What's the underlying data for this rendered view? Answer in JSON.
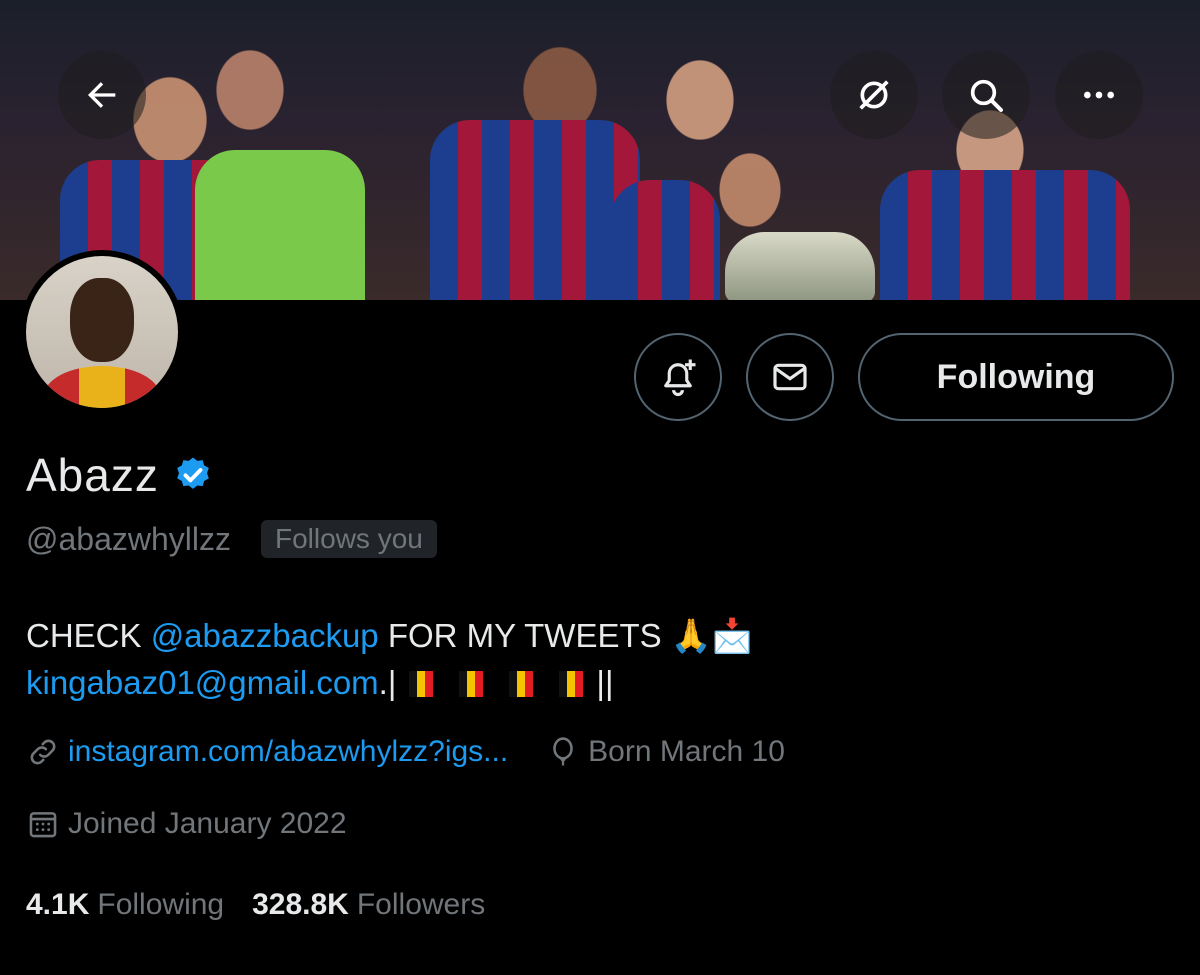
{
  "header": {
    "back_icon": "arrow-left-icon",
    "grok_icon": "slash-circle-icon",
    "search_icon": "search-icon",
    "more_icon": "more-horizontal-icon"
  },
  "profile": {
    "name": "Abazz",
    "verified": true,
    "handle": "@abazwhyllzz",
    "follows_you_label": "Follows you",
    "bio_line1_prefix": "CHECK ",
    "bio_mention": "@abazzbackup",
    "bio_line1_suffix": " FOR MY TWEETS 🙏📩",
    "bio_email": "kingabaz01@gmail.com",
    "bio_email_suffix": ".|",
    "bio_end": "||",
    "website": "instagram.com/abazwhylzz?igs...",
    "birthday": "Born March 10",
    "joined": "Joined January 2022",
    "following_count": "4.1K",
    "following_label": "Following",
    "followers_count": "328.8K",
    "followers_label": "Followers"
  },
  "actions": {
    "notify_icon": "bell-plus-icon",
    "message_icon": "mail-icon",
    "following_button": "Following"
  },
  "colors": {
    "accent": "#1d9bf0",
    "background": "#000000",
    "muted": "#71767b"
  }
}
